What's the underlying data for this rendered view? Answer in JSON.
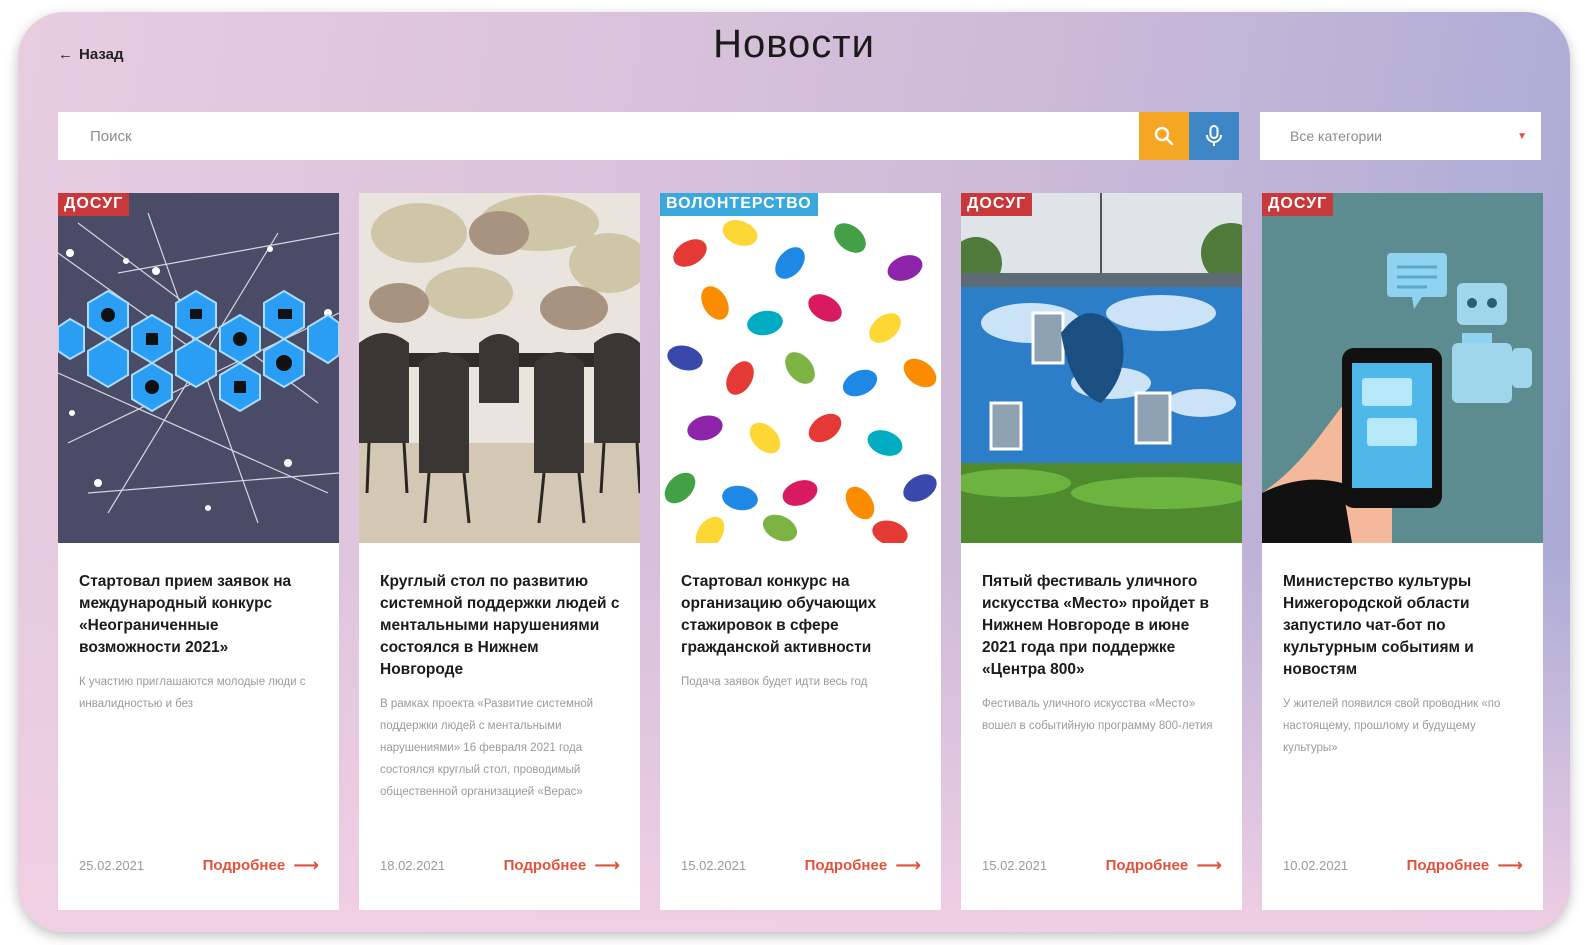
{
  "header": {
    "back_label": "Назад",
    "title": "Новости"
  },
  "search": {
    "placeholder": "Поиск",
    "category_value": "Все категории"
  },
  "more_label": "Подробнее",
  "colors": {
    "accent": "#e2523b",
    "badge_red": "#c8393b",
    "badge_blue": "#3aa7dd",
    "search_button": "#f5a623",
    "mic_button": "#3f86c6"
  },
  "cards": [
    {
      "category": "ДОСУГ",
      "title": "Стартовал прием заявок на международный конкурс «Неограниченные возможности 2021»",
      "excerpt": "К участию приглашаются молодые люди с инвалидностью и без",
      "date": "25.02.2021"
    },
    {
      "category": "",
      "title": "Круглый стол по развитию системной поддержки людей с ментальными нарушениями состоялся в Нижнем Новгороде",
      "excerpt": "В рамках проекта «Развитие системной поддержки людей с ментальными нарушениями» 16 февраля 2021 года состоялся круглый стол, проводимый общественной организацией «Верас»",
      "date": "18.02.2021"
    },
    {
      "category": "ВОЛОНТЕРСТВО",
      "title": "Стартовал конкурс на организацию обучающих стажировок в сфере гражданской активности",
      "excerpt": "Подача заявок будет идти весь год",
      "date": "15.02.2021"
    },
    {
      "category": "ДОСУГ",
      "title": "Пятый фестиваль уличного искусства «Место» пройдет в Нижнем Новгороде в июне 2021 года при поддержке «Центра 800»",
      "excerpt": "Фестиваль уличного искусства «Место» вошел в событийную программу 800-летия",
      "date": "15.02.2021"
    },
    {
      "category": "ДОСУГ",
      "title": "Министерство культуры Нижегородской области запустило чат-бот по культурным событиям и новостям",
      "excerpt": "У жителей появился свой проводник «по настоящему, прошлому и будущему культуры»",
      "date": "10.02.2021"
    }
  ]
}
